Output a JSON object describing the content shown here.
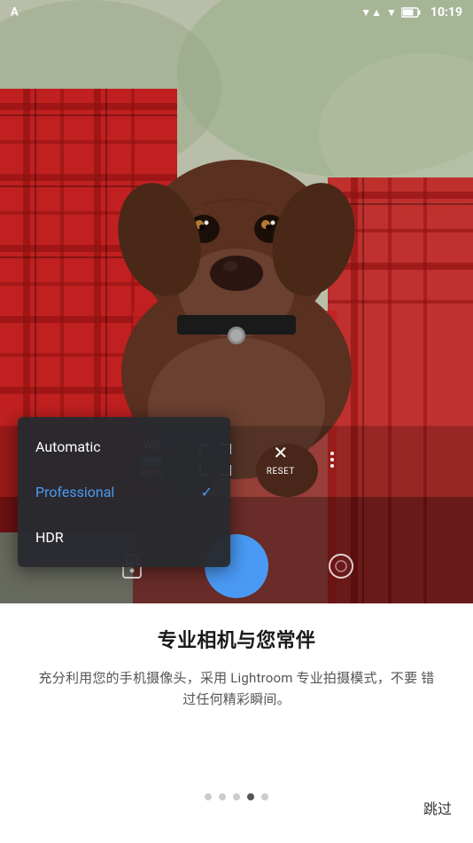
{
  "status_bar": {
    "time": "10:19",
    "signal_icon": "▼▲",
    "wifi_icon": "wifi",
    "battery_icon": "battery"
  },
  "camera": {
    "toolbar": [
      {
        "id": "wb",
        "label": "WB",
        "badge": "AWB",
        "sublabel": "AUTO"
      },
      {
        "id": "focus",
        "label": "",
        "sublabel": ""
      },
      {
        "id": "reset",
        "label": "✕",
        "sublabel": "RESET"
      },
      {
        "id": "more",
        "label": "⋮",
        "sublabel": ""
      }
    ],
    "controls": {
      "lock_icon": "🔓",
      "circle_icon": "○"
    }
  },
  "dropdown": {
    "items": [
      {
        "id": "automatic",
        "label": "Automatic",
        "active": false
      },
      {
        "id": "professional",
        "label": "Professional",
        "active": true
      },
      {
        "id": "hdr",
        "label": "HDR",
        "active": false
      }
    ]
  },
  "onboarding": {
    "title": "专业相机与您常伴",
    "description": "充分利用您的手机摄像头，采用\nLightroom 专业拍摄模式，不要\n错过任何精彩瞬间。",
    "dots": [
      {
        "active": false
      },
      {
        "active": false
      },
      {
        "active": false
      },
      {
        "active": true
      },
      {
        "active": false
      }
    ],
    "skip_label": "跳过"
  }
}
